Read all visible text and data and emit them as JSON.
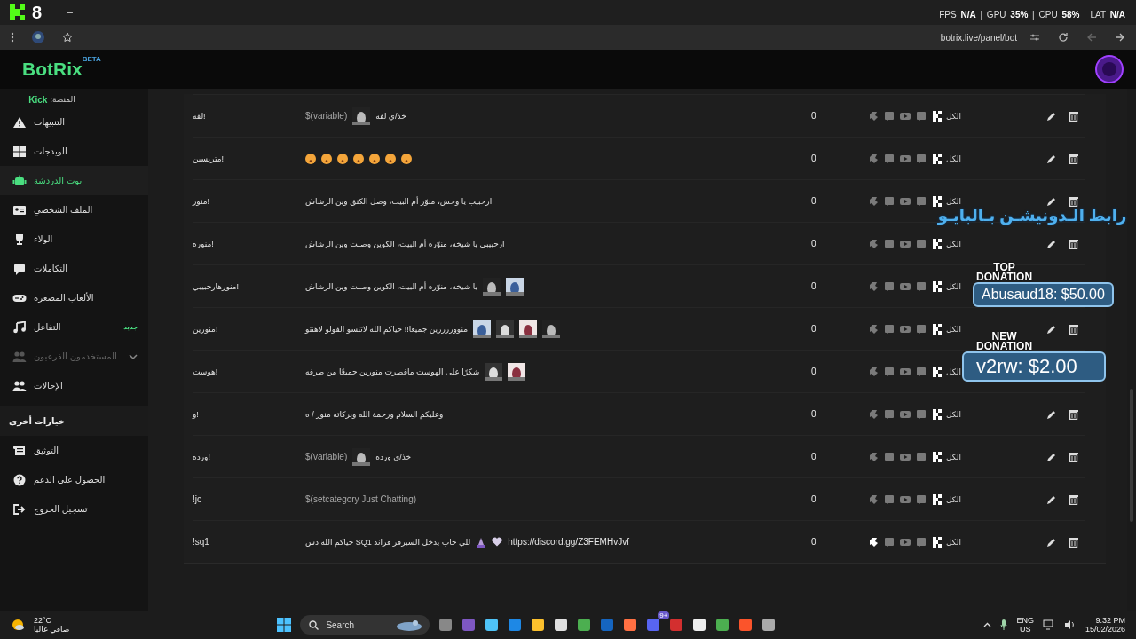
{
  "window": {
    "logo_number": "8",
    "minimize": "–"
  },
  "browser": {
    "url": "botrix.live/panel/bot"
  },
  "stats_overlay": "FPS **N/A** | GPU **35%** | CPU **58%** | LAT **N/A**",
  "header": {
    "logo": "BotRix",
    "badge": "BETA"
  },
  "sidebar": {
    "platform": {
      "label": "المنصة:",
      "value": "Kick"
    },
    "items": [
      {
        "label": "التنبيهات",
        "selected": false,
        "disabled": false
      },
      {
        "label": "الويدجات",
        "selected": false,
        "disabled": false
      },
      {
        "label": "بوت الدردشة",
        "selected": true,
        "disabled": false
      },
      {
        "label": "الملف الشخصي",
        "selected": false,
        "disabled": false
      },
      {
        "label": "الولاء",
        "selected": false,
        "disabled": false
      },
      {
        "label": "التكاملات",
        "selected": false,
        "disabled": false
      },
      {
        "label": "الألعاب المصغرة",
        "selected": false,
        "disabled": false
      },
      {
        "label": "التفاعل",
        "selected": false,
        "disabled": false,
        "badge": "جديد"
      },
      {
        "label": "المستخدمون الفرعيون",
        "selected": false,
        "disabled": true,
        "expandable": true
      },
      {
        "label": "الإحالات",
        "selected": false,
        "disabled": false
      }
    ],
    "section": "خيارات أخرى",
    "other_items": [
      {
        "label": "التوثيق"
      },
      {
        "label": "الحصول على الدعم"
      },
      {
        "label": "تسجيل الخروج"
      }
    ]
  },
  "table": {
    "rows": [
      {
        "command": "!لفه",
        "response": [
          {
            "kind": "text",
            "text": "خذ/ي لفه"
          },
          {
            "kind": "picture"
          },
          {
            "kind": "variable",
            "text": "$(variable)"
          }
        ],
        "uses": "0",
        "platform_on": [
          false,
          false,
          false,
          false,
          true
        ],
        "scope": "الكل"
      },
      {
        "command": "!متربسين",
        "response": [
          {
            "kind": "emoji"
          },
          {
            "kind": "emoji"
          },
          {
            "kind": "emoji"
          },
          {
            "kind": "emoji"
          },
          {
            "kind": "emoji"
          },
          {
            "kind": "emoji"
          },
          {
            "kind": "emoji"
          }
        ],
        "uses": "0",
        "platform_on": [
          false,
          false,
          false,
          false,
          true
        ],
        "scope": "الكل"
      },
      {
        "command": "!منور",
        "response": [
          {
            "kind": "text",
            "text": "ارحبيب يا وحش، منوّر أم البيت، وصل الكنق وين الرشاش"
          }
        ],
        "uses": "0",
        "platform_on": [
          false,
          false,
          false,
          false,
          true
        ],
        "scope": "الكل"
      },
      {
        "command": "!منوره",
        "response": [
          {
            "kind": "text",
            "text": "ارحبيبي يا شيخه، منوّره أم البيت، الكوين وصلت وين الرشاش"
          }
        ],
        "uses": "0",
        "platform_on": [
          false,
          false,
          false,
          false,
          true
        ],
        "scope": "الكل"
      },
      {
        "command": "!منورهارحبيبي",
        "response": [
          {
            "kind": "picture"
          },
          {
            "kind": "picture"
          },
          {
            "kind": "text",
            "text": "يا شيخه، منوّره أم البيت، الكوين وصلت وين الرشاش"
          }
        ],
        "uses": "0",
        "platform_on": [
          false,
          false,
          false,
          false,
          true
        ],
        "scope": "الكل"
      },
      {
        "command": "!منورين",
        "response": [
          {
            "kind": "picture"
          },
          {
            "kind": "picture"
          },
          {
            "kind": "picture"
          },
          {
            "kind": "picture"
          },
          {
            "kind": "text",
            "text": "منووررررين جميعا!! حياكم الله لاتنسو الفولو لاهنتو"
          }
        ],
        "uses": "0",
        "platform_on": [
          false,
          false,
          false,
          false,
          true
        ],
        "scope": "الكل"
      },
      {
        "command": "!هوست",
        "response": [
          {
            "kind": "picture"
          },
          {
            "kind": "picture"
          },
          {
            "kind": "text",
            "text": "شكرًا على الهوست ماقصرت منورين جميعًا من طرفه"
          }
        ],
        "uses": "0",
        "platform_on": [
          false,
          false,
          false,
          false,
          true
        ],
        "scope": "الكل"
      },
      {
        "command": "!و",
        "response": [
          {
            "kind": "text",
            "text": "وعليكم السلام ورحمة الله وبركاته منور / ه"
          }
        ],
        "uses": "0",
        "platform_on": [
          false,
          false,
          false,
          false,
          true
        ],
        "scope": "الكل"
      },
      {
        "command": "!ورده",
        "response": [
          {
            "kind": "text",
            "text": "خذ/ي ورده"
          },
          {
            "kind": "picture"
          },
          {
            "kind": "variable",
            "text": "$(variable)"
          }
        ],
        "uses": "0",
        "platform_on": [
          false,
          false,
          false,
          false,
          true
        ],
        "scope": "الكل"
      },
      {
        "command": "!jc",
        "response": [
          {
            "kind": "variable",
            "text": "$(setcategory Just Chatting)"
          }
        ],
        "uses": "0",
        "platform_on": [
          false,
          false,
          false,
          false,
          true
        ],
        "scope": "الكل"
      },
      {
        "command": "!sq1",
        "response": [
          {
            "kind": "link",
            "text": "https://discord.gg/Z3FEMHvJvf"
          },
          {
            "kind": "heart"
          },
          {
            "kind": "pray"
          },
          {
            "kind": "text",
            "text": "للي حاب يدخل السيرفر قراند SQ1 حياكم الله دس"
          }
        ],
        "uses": "0",
        "platform_on": [
          true,
          false,
          false,
          false,
          true
        ],
        "scope": "الكل"
      }
    ]
  },
  "banner_overlay": "رابط الـدونيشـن بـالبايـو",
  "donations": [
    {
      "title_1": "TOP",
      "title_2": "DONATION",
      "text": "Abusaud18: $50.00"
    },
    {
      "title_1": "NEW",
      "title_2": "DONATION",
      "text": "v2rw: $2.00"
    }
  ],
  "taskbar": {
    "weather": {
      "temp": "22°C",
      "desc": "صافي غالبا"
    },
    "search": "Search",
    "discord_badge": "9+",
    "lang_1": "ENG",
    "lang_2": "US",
    "time": "9:32 PM",
    "date": "15/02/2026"
  }
}
